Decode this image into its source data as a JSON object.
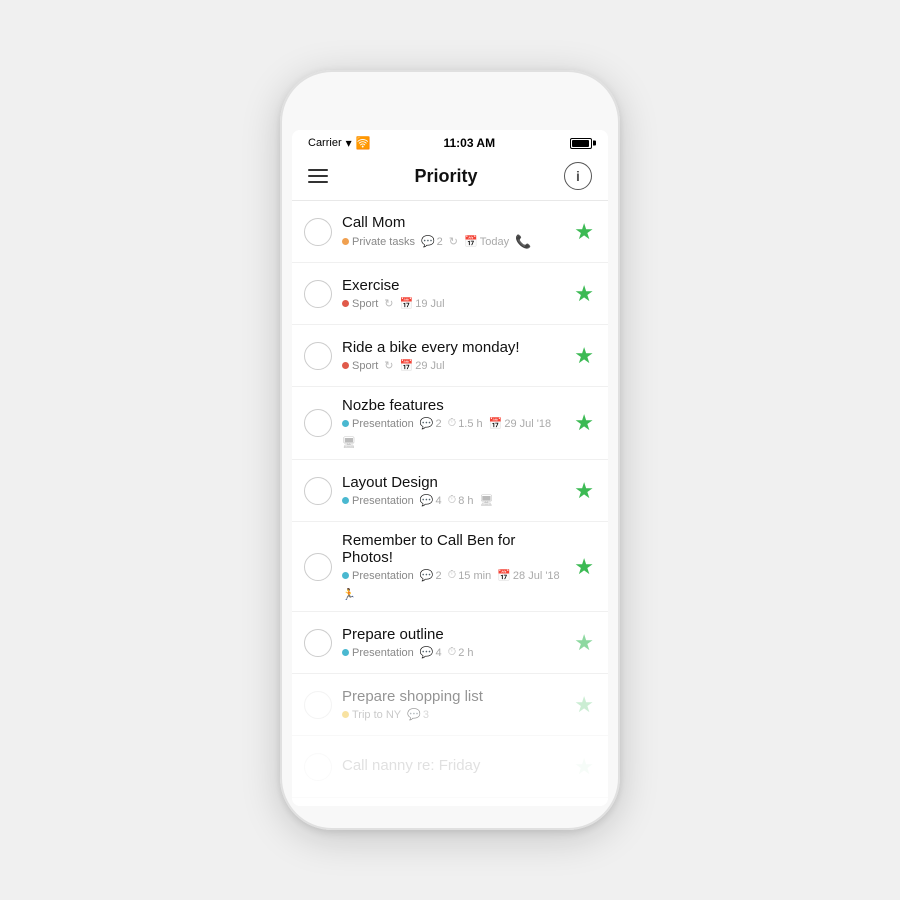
{
  "status_bar": {
    "carrier": "Carrier",
    "time": "11:03 AM"
  },
  "nav": {
    "title": "Priority",
    "info_label": "i"
  },
  "tasks": [
    {
      "id": 1,
      "title": "Call Mom",
      "tag": "Private tasks",
      "tag_color": "orange",
      "meta": [
        {
          "icon": "💬",
          "value": "2"
        },
        {
          "icon": "↻",
          "value": ""
        },
        {
          "icon": "📅",
          "value": "Today"
        },
        {
          "icon": "📞",
          "value": ""
        }
      ],
      "star": "★",
      "faded": false
    },
    {
      "id": 2,
      "title": "Exercise",
      "tag": "Sport",
      "tag_color": "red",
      "meta": [
        {
          "icon": "↻",
          "value": ""
        },
        {
          "icon": "📅",
          "value": "19 Jul"
        }
      ],
      "star": "★",
      "faded": false
    },
    {
      "id": 3,
      "title": "Ride a bike every monday!",
      "tag": "Sport",
      "tag_color": "red",
      "meta": [
        {
          "icon": "↻",
          "value": ""
        },
        {
          "icon": "📅",
          "value": "29 Jul"
        }
      ],
      "star": "★",
      "faded": false
    },
    {
      "id": 4,
      "title": "Nozbe features",
      "tag": "Presentation",
      "tag_color": "blue",
      "meta": [
        {
          "icon": "💬",
          "value": "2"
        },
        {
          "icon": "⏱",
          "value": "1.5 h"
        },
        {
          "icon": "📅",
          "value": "29 Jul '18"
        },
        {
          "icon": "🖥",
          "value": ""
        }
      ],
      "star": "★",
      "faded": false
    },
    {
      "id": 5,
      "title": "Layout Design",
      "tag": "Presentation",
      "tag_color": "blue",
      "meta": [
        {
          "icon": "💬",
          "value": "4"
        },
        {
          "icon": "⏱",
          "value": "8 h"
        },
        {
          "icon": "🖥",
          "value": ""
        }
      ],
      "star": "★",
      "faded": false
    },
    {
      "id": 6,
      "title": "Remember to Call Ben for Photos!",
      "tag": "Presentation",
      "tag_color": "blue",
      "meta": [
        {
          "icon": "💬",
          "value": "2"
        },
        {
          "icon": "⏱",
          "value": "15 min"
        },
        {
          "icon": "📅",
          "value": "28 Jul '18"
        },
        {
          "icon": "🏃",
          "value": ""
        }
      ],
      "star": "★",
      "faded": false
    },
    {
      "id": 7,
      "title": "Prepare outline",
      "tag": "Presentation",
      "tag_color": "blue",
      "meta": [
        {
          "icon": "💬",
          "value": "4"
        },
        {
          "icon": "⏱",
          "value": "2 h"
        }
      ],
      "star": "★",
      "faded": false
    },
    {
      "id": 8,
      "title": "Prepare shopping list",
      "tag": "Trip to NY",
      "tag_color": "yellow",
      "meta": [
        {
          "icon": "💬",
          "value": "3"
        }
      ],
      "star": "★",
      "faded": true
    },
    {
      "id": 9,
      "title": "Call nanny re: Friday",
      "tag": "",
      "tag_color": "",
      "meta": [],
      "star": "★",
      "faded": true,
      "very_faded": true
    }
  ]
}
